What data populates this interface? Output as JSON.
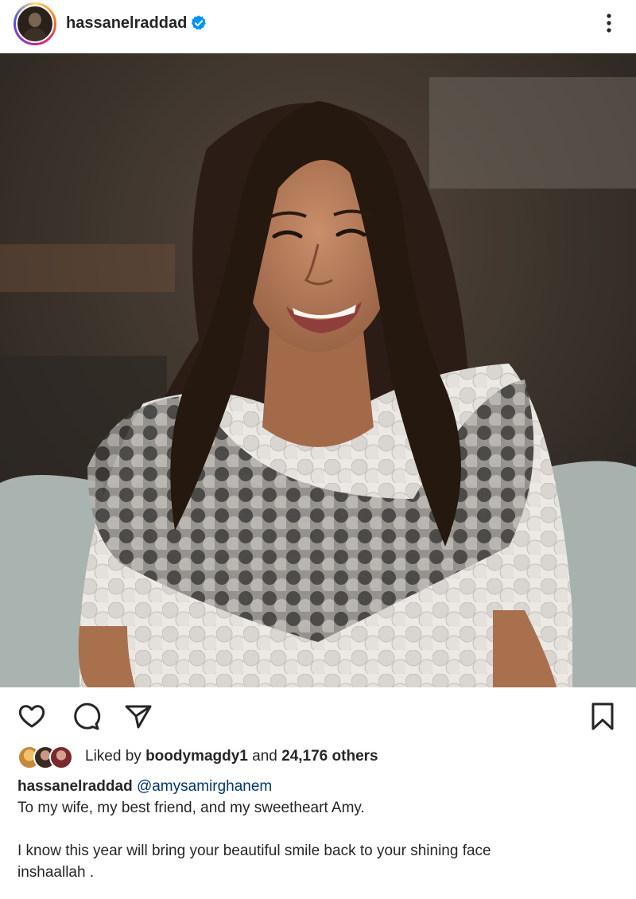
{
  "post": {
    "username": "hassanelraddad",
    "verified": true,
    "more_icon": "more-vertical-icon",
    "image_description_icon": "post-photo"
  },
  "actions": {
    "like_icon": "heart-icon",
    "comment_icon": "comment-icon",
    "share_icon": "share-icon",
    "save_icon": "bookmark-icon"
  },
  "likes": {
    "prefix": "Liked by",
    "liked_user": "boodymagdy1",
    "conjunction": "and",
    "others": "24,176 others"
  },
  "caption": {
    "username": "hassanelraddad",
    "mention": "@amysamirghanem",
    "line1": "To my wife, my best friend, and my sweetheart Amy.",
    "line2": "I know this year will bring your beautiful smile back to your shining face",
    "line3": "inshaallah ."
  },
  "colors": {
    "verified_blue": "#0095f6",
    "mention": "#00376b",
    "text": "#262626"
  }
}
